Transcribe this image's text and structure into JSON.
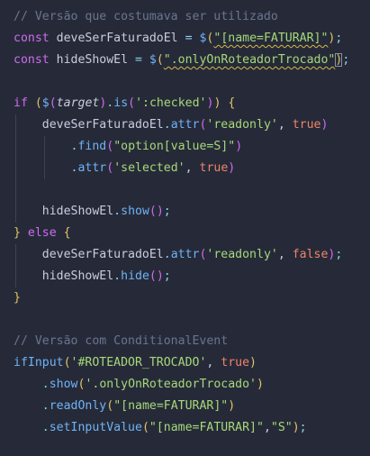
{
  "editor": {
    "lines": [
      {
        "indent": 0,
        "guides": 0,
        "tokens": [
          {
            "t": "// Versão que costumava ser utilizado",
            "c": "t-comment"
          }
        ]
      },
      {
        "indent": 0,
        "guides": 0,
        "tokens": [
          {
            "t": "const",
            "c": "t-kw"
          },
          {
            "t": " deveSerFaturadoEl ",
            "c": "t-var"
          },
          {
            "t": "=",
            "c": "t-op"
          },
          {
            "t": " ",
            "c": "t-var"
          },
          {
            "t": "$",
            "c": "t-fn"
          },
          {
            "t": "(",
            "c": "t-paren-y"
          },
          {
            "t": "\"[name=FATURAR]\"",
            "c": "t-str squiggle"
          },
          {
            "t": ")",
            "c": "t-paren-y"
          },
          {
            "t": ";",
            "c": "t-punc"
          }
        ]
      },
      {
        "indent": 0,
        "guides": 0,
        "tokens": [
          {
            "t": "const",
            "c": "t-kw"
          },
          {
            "t": " hideShowEl ",
            "c": "t-var"
          },
          {
            "t": "=",
            "c": "t-op"
          },
          {
            "t": " ",
            "c": "t-var"
          },
          {
            "t": "$",
            "c": "t-fn"
          },
          {
            "t": "(",
            "c": "t-paren-y"
          },
          {
            "t": "\".onlyOnRoteadorTrocado\"",
            "c": "t-str squiggle"
          },
          {
            "t": ")",
            "c": "t-paren-y paren-box"
          },
          {
            "t": ";",
            "c": "t-punc"
          }
        ]
      },
      {
        "indent": 0,
        "guides": 0,
        "tokens": []
      },
      {
        "indent": 0,
        "guides": 0,
        "tokens": [
          {
            "t": "if",
            "c": "t-kw"
          },
          {
            "t": " ",
            "c": "t-var"
          },
          {
            "t": "(",
            "c": "t-paren-y"
          },
          {
            "t": "$",
            "c": "t-fn"
          },
          {
            "t": "(",
            "c": "t-paren-m"
          },
          {
            "t": "target",
            "c": "t-italic"
          },
          {
            "t": ")",
            "c": "t-paren-m"
          },
          {
            "t": ".",
            "c": "t-punc"
          },
          {
            "t": "is",
            "c": "t-fn"
          },
          {
            "t": "(",
            "c": "t-paren-m"
          },
          {
            "t": "':checked'",
            "c": "t-str"
          },
          {
            "t": ")",
            "c": "t-paren-m"
          },
          {
            "t": ")",
            "c": "t-paren-y"
          },
          {
            "t": " ",
            "c": "t-var"
          },
          {
            "t": "{",
            "c": "t-brace"
          }
        ]
      },
      {
        "indent": 4,
        "guides": 1,
        "tokens": [
          {
            "t": "deveSerFaturadoEl",
            "c": "t-var"
          },
          {
            "t": ".",
            "c": "t-punc"
          },
          {
            "t": "attr",
            "c": "t-fn"
          },
          {
            "t": "(",
            "c": "t-paren-m"
          },
          {
            "t": "'readonly'",
            "c": "t-str"
          },
          {
            "t": ", ",
            "c": "t-var"
          },
          {
            "t": "true",
            "c": "t-bool"
          },
          {
            "t": ")",
            "c": "t-paren-m"
          }
        ]
      },
      {
        "indent": 8,
        "guides": 2,
        "tokens": [
          {
            "t": ".",
            "c": "t-punc"
          },
          {
            "t": "find",
            "c": "t-fn"
          },
          {
            "t": "(",
            "c": "t-paren-m"
          },
          {
            "t": "\"option[value=S]\"",
            "c": "t-str"
          },
          {
            "t": ")",
            "c": "t-paren-m"
          }
        ]
      },
      {
        "indent": 8,
        "guides": 2,
        "tokens": [
          {
            "t": ".",
            "c": "t-punc"
          },
          {
            "t": "attr",
            "c": "t-fn"
          },
          {
            "t": "(",
            "c": "t-paren-m"
          },
          {
            "t": "'selected'",
            "c": "t-str"
          },
          {
            "t": ", ",
            "c": "t-var"
          },
          {
            "t": "true",
            "c": "t-bool"
          },
          {
            "t": ")",
            "c": "t-paren-m"
          }
        ]
      },
      {
        "indent": 0,
        "guides": 1,
        "tokens": []
      },
      {
        "indent": 4,
        "guides": 1,
        "tokens": [
          {
            "t": "hideShowEl",
            "c": "t-var"
          },
          {
            "t": ".",
            "c": "t-punc"
          },
          {
            "t": "show",
            "c": "t-fn"
          },
          {
            "t": "()",
            "c": "t-paren-m"
          },
          {
            "t": ";",
            "c": "t-punc"
          }
        ]
      },
      {
        "indent": 0,
        "guides": 0,
        "tokens": [
          {
            "t": "}",
            "c": "t-brace"
          },
          {
            "t": " else ",
            "c": "t-kw"
          },
          {
            "t": "{",
            "c": "t-brace"
          }
        ]
      },
      {
        "indent": 4,
        "guides": 1,
        "tokens": [
          {
            "t": "deveSerFaturadoEl",
            "c": "t-var"
          },
          {
            "t": ".",
            "c": "t-punc"
          },
          {
            "t": "attr",
            "c": "t-fn"
          },
          {
            "t": "(",
            "c": "t-paren-m"
          },
          {
            "t": "'readonly'",
            "c": "t-str"
          },
          {
            "t": ", ",
            "c": "t-var"
          },
          {
            "t": "false",
            "c": "t-bool"
          },
          {
            "t": ")",
            "c": "t-paren-m"
          },
          {
            "t": ";",
            "c": "t-punc"
          }
        ]
      },
      {
        "indent": 4,
        "guides": 1,
        "tokens": [
          {
            "t": "hideShowEl",
            "c": "t-var"
          },
          {
            "t": ".",
            "c": "t-punc"
          },
          {
            "t": "hide",
            "c": "t-fn"
          },
          {
            "t": "()",
            "c": "t-paren-m"
          },
          {
            "t": ";",
            "c": "t-punc"
          }
        ]
      },
      {
        "indent": 0,
        "guides": 0,
        "tokens": [
          {
            "t": "}",
            "c": "t-brace"
          }
        ]
      },
      {
        "indent": 0,
        "guides": 0,
        "tokens": []
      },
      {
        "indent": 0,
        "guides": 0,
        "tokens": [
          {
            "t": "// Versão com ConditionalEvent",
            "c": "t-comment"
          }
        ]
      },
      {
        "indent": 0,
        "guides": 0,
        "tokens": [
          {
            "t": "ifInput",
            "c": "t-fn"
          },
          {
            "t": "(",
            "c": "t-paren-y"
          },
          {
            "t": "'#ROTEADOR_TROCADO'",
            "c": "t-str"
          },
          {
            "t": ", ",
            "c": "t-var"
          },
          {
            "t": "true",
            "c": "t-bool"
          },
          {
            "t": ")",
            "c": "t-paren-y"
          }
        ]
      },
      {
        "indent": 4,
        "guides": 0,
        "tokens": [
          {
            "t": ".",
            "c": "t-punc"
          },
          {
            "t": "show",
            "c": "t-fn"
          },
          {
            "t": "(",
            "c": "t-paren-y"
          },
          {
            "t": "'.onlyOnRoteadorTrocado'",
            "c": "t-str"
          },
          {
            "t": ")",
            "c": "t-paren-y"
          }
        ]
      },
      {
        "indent": 4,
        "guides": 0,
        "tokens": [
          {
            "t": ".",
            "c": "t-punc"
          },
          {
            "t": "readOnly",
            "c": "t-fn"
          },
          {
            "t": "(",
            "c": "t-paren-y"
          },
          {
            "t": "\"[name=FATURAR]\"",
            "c": "t-str"
          },
          {
            "t": ")",
            "c": "t-paren-y"
          }
        ]
      },
      {
        "indent": 4,
        "guides": 0,
        "tokens": [
          {
            "t": ".",
            "c": "t-punc"
          },
          {
            "t": "setInputValue",
            "c": "t-fn"
          },
          {
            "t": "(",
            "c": "t-paren-y"
          },
          {
            "t": "\"[name=FATURAR]\"",
            "c": "t-str"
          },
          {
            "t": ",",
            "c": "t-var"
          },
          {
            "t": "\"S\"",
            "c": "t-str"
          },
          {
            "t": ")",
            "c": "t-paren-y"
          },
          {
            "t": ";",
            "c": "t-punc"
          }
        ]
      }
    ]
  }
}
